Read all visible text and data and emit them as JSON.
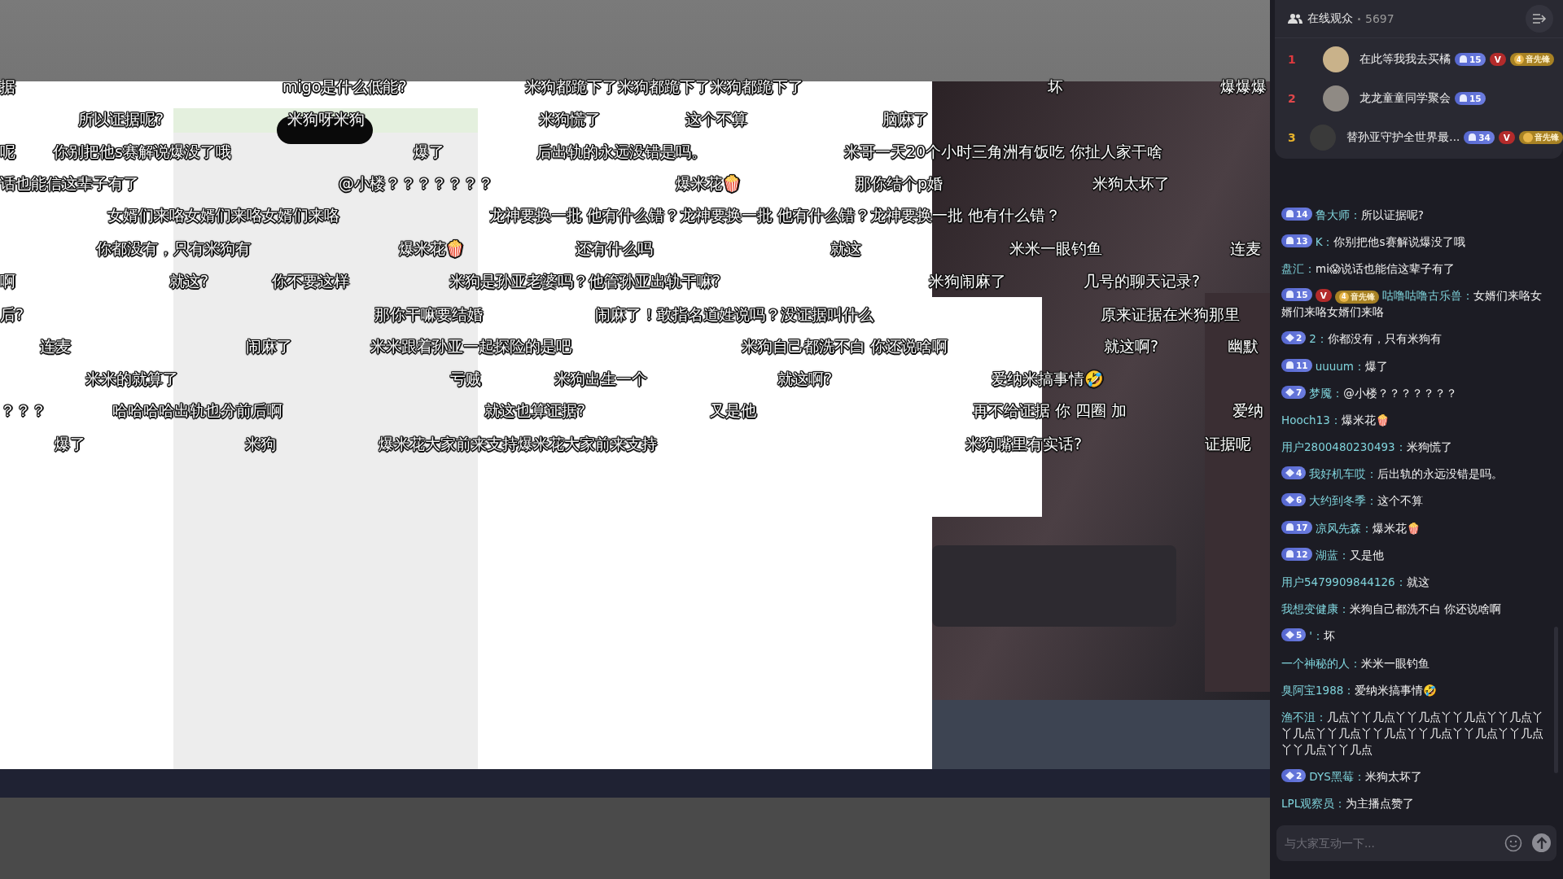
{
  "danmaku_rows": [
    [
      {
        "text": "据"
      },
      {
        "text": "migo是什么低能?"
      },
      {
        "text": "米狗都跪下了米狗都跪下了米狗都跪下了"
      },
      {
        "text": "坏"
      },
      {
        "text": "爆爆爆"
      }
    ],
    [
      {
        "text": "所以证据呢?"
      },
      {
        "text": "米狗呀米狗"
      },
      {
        "text": "米狗慌了"
      },
      {
        "text": "这个不算"
      },
      {
        "text": "脑麻了"
      }
    ],
    [
      {
        "text": "呢"
      },
      {
        "text": "你别把他s赛解说爆没了哦"
      },
      {
        "text": "爆了"
      },
      {
        "text": "后出轨的永远没错是吗。"
      },
      {
        "text": "米哥一天20个小时三角洲有饭吃 你扯人家干啥"
      }
    ],
    [
      {
        "text": "话也能信这辈子有了"
      },
      {
        "text": "@小楼？？？？？？？"
      },
      {
        "text": "爆米花🍿"
      },
      {
        "text": "那你结个p婚"
      },
      {
        "text": "米狗太坏了"
      }
    ],
    [
      {
        "text": "女婿们来咯女婿们来咯女婿们来咯"
      },
      {
        "text": "龙神要换一批 他有什么错？龙神要换一批 他有什么错？龙神要换一批 他有什么错？"
      }
    ],
    [
      {
        "text": "你都没有，只有米狗有"
      },
      {
        "text": "爆米花🍿"
      },
      {
        "text": "还有什么吗"
      },
      {
        "text": "就这"
      },
      {
        "text": "米米一眼钓鱼"
      },
      {
        "text": "连麦"
      }
    ],
    [
      {
        "text": "啊"
      },
      {
        "text": "就这?"
      },
      {
        "text": "你不要这样"
      },
      {
        "text": "米狗是孙亚老婆吗？他管孙亚出轨干嘛?"
      },
      {
        "text": "米狗闹麻了"
      },
      {
        "text": "几号的聊天记录?"
      }
    ],
    [
      {
        "text": "后?"
      },
      {
        "text": "那你干嘛要结婚"
      },
      {
        "text": "闹麻了！敢指名道姓说吗？没证据叫什么"
      },
      {
        "text": "原来证据在米狗那里"
      }
    ],
    [
      {
        "text": "连麦"
      },
      {
        "text": "闹麻了"
      },
      {
        "text": "米米跟着孙亚一起探险的是吧"
      },
      {
        "text": "米狗自己都洗不白 你还说啥啊"
      },
      {
        "text": "就这啊?"
      },
      {
        "text": "幽默"
      }
    ],
    [
      {
        "text": "米米的就算了"
      },
      {
        "text": "亏贼"
      },
      {
        "text": "米狗出生一个"
      },
      {
        "text": "就这啊?"
      },
      {
        "text": "爱纳米搞事情🤣"
      }
    ],
    [
      {
        "text": "？？？"
      },
      {
        "text": "哈哈哈哈出轨也分前后啊"
      },
      {
        "text": "就这也算证据?"
      },
      {
        "text": "又是他"
      },
      {
        "text": "再不给证据 你 四圈 加"
      },
      {
        "text": "爱纳"
      }
    ],
    [
      {
        "text": "爆了"
      },
      {
        "text": "米狗"
      },
      {
        "text": "爆米花大家前来支持爆米花大家前来支持"
      },
      {
        "text": "米狗嘴里有实话?"
      },
      {
        "text": "证据呢"
      }
    ]
  ],
  "viewers": {
    "title": "在线观众",
    "count": "5697",
    "top": [
      {
        "rank": "1",
        "color": "#e0393e",
        "name": "在此等我我去买橘",
        "badges": [
          {
            "kind": "fan",
            "level": "15"
          },
          {
            "kind": "vip",
            "label": "V"
          },
          {
            "kind": "pioneer",
            "level": "4",
            "label": "音先锋"
          }
        ]
      },
      {
        "rank": "2",
        "color": "#e0474b",
        "name": "龙龙童童同学聚会",
        "badges": [
          {
            "kind": "fan",
            "level": "15"
          }
        ]
      },
      {
        "rank": "3",
        "color": "#e8b32c",
        "name": "替孙亚守护全世界最...",
        "badges": [
          {
            "kind": "fan",
            "level": "34"
          },
          {
            "kind": "vip",
            "label": "V"
          },
          {
            "kind": "pioneer",
            "label": "音先锋"
          }
        ]
      }
    ]
  },
  "chat": [
    {
      "badges": [
        {
          "kind": "fan",
          "level": "14"
        }
      ],
      "user": "鲁大师：",
      "text": "所以证据呢?"
    },
    {
      "badges": [
        {
          "kind": "fan",
          "level": "13"
        }
      ],
      "user": "K：",
      "text": "你别把他s赛解说爆没了哦"
    },
    {
      "user": "盘汇：",
      "text": "mi😱说话也能信这辈子有了"
    },
    {
      "badges": [
        {
          "kind": "fan",
          "level": "15"
        },
        {
          "kind": "vip",
          "label": "V"
        },
        {
          "kind": "pioneer",
          "level": "4",
          "label": "音先锋"
        }
      ],
      "user": "咕噜咕噜古乐兽：",
      "text": "女婿们来咯女婿们来咯女婿们来咯"
    },
    {
      "badges": [
        {
          "kind": "diamond",
          "level": "2"
        }
      ],
      "user": "2：",
      "text": "你都没有，只有米狗有"
    },
    {
      "badges": [
        {
          "kind": "fan",
          "level": "11"
        }
      ],
      "user": "uuuum：",
      "text": "爆了"
    },
    {
      "badges": [
        {
          "kind": "diamond",
          "level": "7"
        }
      ],
      "user": "梦魇：",
      "text": "@小楼？？？？？？？"
    },
    {
      "user": "Hooch13：",
      "text": "爆米花🍿"
    },
    {
      "user": "用户2800480230493：",
      "text": "米狗慌了"
    },
    {
      "badges": [
        {
          "kind": "diamond",
          "level": "4"
        }
      ],
      "user": "我好机车哎：",
      "text": "后出轨的永远没错是吗。"
    },
    {
      "badges": [
        {
          "kind": "diamond",
          "level": "6"
        }
      ],
      "user": "大约到冬季：",
      "text": "这个不算"
    },
    {
      "badges": [
        {
          "kind": "fan",
          "level": "17"
        }
      ],
      "user": "凉风先森：",
      "text": "爆米花🍿"
    },
    {
      "badges": [
        {
          "kind": "fan",
          "level": "12"
        }
      ],
      "user": "湖蓝：",
      "text": "又是他"
    },
    {
      "user": "用户5479909844126：",
      "text": "就这"
    },
    {
      "user": "我想变健康：",
      "text": "米狗自己都洗不白 你还说啥啊"
    },
    {
      "badges": [
        {
          "kind": "diamond",
          "level": "5"
        }
      ],
      "user": "'：",
      "text": "坏"
    },
    {
      "user": "一个神秘的人：",
      "text": "米米一眼钓鱼"
    },
    {
      "user": "臭阿宝1988：",
      "text": "爱纳米搞事情🤣"
    },
    {
      "user": "渔不沮：",
      "text": "几点丫丫几点丫丫几点丫丫几点丫丫几点丫丫几点丫丫几点丫丫几点丫丫几点丫丫几点丫丫几点丫丫几点丫丫几点"
    },
    {
      "badges": [
        {
          "kind": "diamond",
          "level": "2"
        }
      ],
      "user": "DYS黑莓：",
      "text": "米狗太坏了"
    },
    {
      "user": "LPL观察员：",
      "text": "为主播点赞了"
    }
  ],
  "input": {
    "placeholder": "与大家互动一下..."
  }
}
